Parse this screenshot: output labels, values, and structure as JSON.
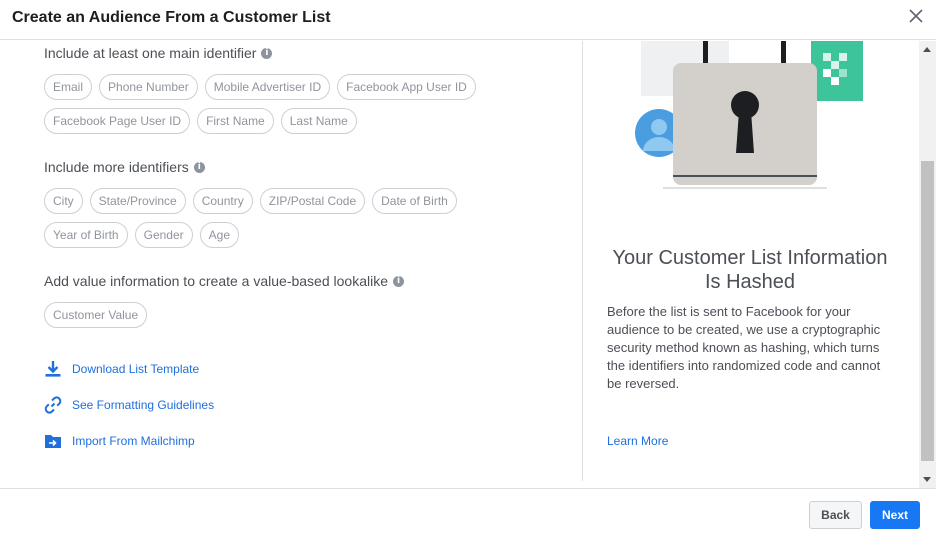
{
  "dialog": {
    "title": "Create an Audience From a Customer List"
  },
  "main_identifiers": {
    "label": "Include at least one main identifier",
    "row1": [
      "Email",
      "Phone Number",
      "Mobile Advertiser ID",
      "Facebook App User ID"
    ],
    "row2": [
      "Facebook Page User ID",
      "First Name",
      "Last Name"
    ]
  },
  "more_identifiers": {
    "label": "Include more identifiers",
    "row1": [
      "City",
      "State/Province",
      "Country",
      "ZIP/Postal Code",
      "Date of Birth"
    ],
    "row2": [
      "Year of Birth",
      "Gender",
      "Age"
    ]
  },
  "value_info": {
    "label": "Add value information to create a value-based lookalike",
    "pills": [
      "Customer Value"
    ]
  },
  "links": {
    "download": "Download List Template",
    "formatting": "See Formatting Guidelines",
    "import": "Import From Mailchimp"
  },
  "info_panel": {
    "title": "Your Customer List Information Is Hashed",
    "body": "Before the list is sent to Facebook for your audience to be created, we use a cryptographic security method known as hashing, which turns the identifiers into randomized code and cannot be reversed.",
    "learn_more": "Learn More"
  },
  "footer": {
    "back": "Back",
    "next": "Next"
  },
  "colors": {
    "link": "#216fdb",
    "primary_button": "#1877f2",
    "accent_teal": "#3ec49a",
    "avatar_blue": "#4a9ee0"
  },
  "icons": [
    "close-icon",
    "info-icon",
    "download-icon",
    "link-icon",
    "folder-import-icon",
    "lock-illustration"
  ]
}
